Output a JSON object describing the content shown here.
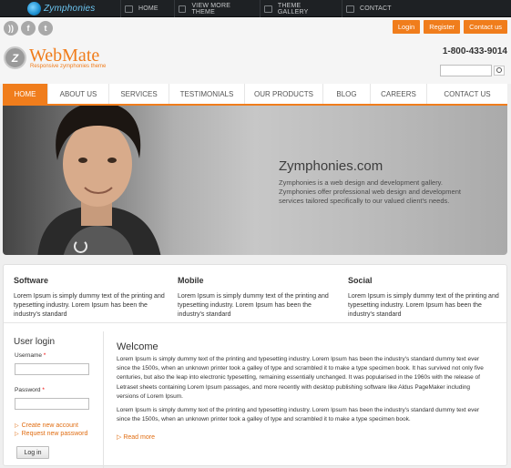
{
  "topbar": {
    "brand": "Zymphonies",
    "nav": [
      "HOME",
      "VIEW MORE THEME",
      "THEME GALLERY",
      "CONTACT"
    ]
  },
  "header": {
    "account_buttons": [
      "Login",
      "Register",
      "Contact us"
    ],
    "site_name": "WebMate",
    "tagline": "Responsive zymphonies theme",
    "phone": "1-800-433-9014",
    "search_placeholder": ""
  },
  "social_icons": [
    "rss-icon",
    "facebook-icon",
    "twitter-icon"
  ],
  "main_nav": [
    "HOME",
    "ABOUT US",
    "SERVICES",
    "TESTIMONIALS",
    "OUR PRODUCTS",
    "BLOG",
    "CAREERS",
    "CONTACT US"
  ],
  "hero": {
    "title": "Zymphonies.com",
    "text": "Zymphonies is a web design and development gallery. Zymphonies offer professional web design and development services tailored specifically to our valued client's needs."
  },
  "features": [
    {
      "title": "Software",
      "text": "Lorem Ipsum is simply dummy text of the printing and typesetting industry. Lorem Ipsum has been the industry's standard"
    },
    {
      "title": "Mobile",
      "text": "Lorem Ipsum is simply dummy text of the printing and typesetting industry. Lorem Ipsum has been the industry's standard"
    },
    {
      "title": "Social",
      "text": "Lorem Ipsum is simply dummy text of the printing and typesetting industry. Lorem Ipsum has been the industry's standard"
    }
  ],
  "login": {
    "title": "User login",
    "username_label": "Username",
    "password_label": "Password",
    "required_mark": "*",
    "create_account": "Create new account",
    "request_password": "Request new password",
    "submit": "Log in"
  },
  "welcome": {
    "title": "Welcome",
    "paragraph1": "Lorem Ipsum is simply dummy text of the printing and typesetting industry. Lorem Ipsum has been the industry's standard dummy text ever since the 1500s, when an unknown printer took a galley of type and scrambled it to make a type specimen book. It has survived not only five centuries, but also the leap into electronic typesetting, remaining essentially unchanged. It was popularised in the 1960s with the release of Letraset sheets containing Lorem Ipsum passages, and more recently with desktop publishing software like Aldus PageMaker including versions of Lorem Ipsum.",
    "paragraph2": "Lorem Ipsum is simply dummy text of the printing and typesetting industry. Lorem Ipsum has been the industry's standard dummy text ever since the 1500s, when an unknown printer took a galley of type and scrambled it to make a type specimen book.",
    "read_more": "Read more"
  },
  "colors": {
    "accent": "#f07d1c",
    "topbar": "#1e2124",
    "link": "#e06d12"
  }
}
